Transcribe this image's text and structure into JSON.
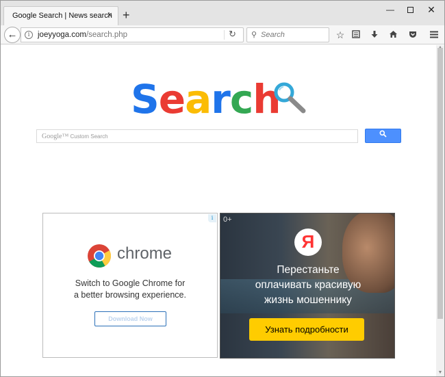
{
  "browser": {
    "tab_title": "Google Search | News search",
    "tab_close": "×",
    "new_tab": "+",
    "url_host": "joeyyoga.com",
    "url_path": "/search.php",
    "search_placeholder": "Search",
    "window_min": "—",
    "window_close": "✕"
  },
  "page": {
    "logo_letters": [
      {
        "char": "S",
        "color": "#1f74ea"
      },
      {
        "char": "e",
        "color": "#ea3b33"
      },
      {
        "char": "a",
        "color": "#fbbc05"
      },
      {
        "char": "r",
        "color": "#1f74ea"
      },
      {
        "char": "c",
        "color": "#34a853"
      },
      {
        "char": "h",
        "color": "#ea3b33"
      }
    ],
    "custom_search_brand": "Google™",
    "custom_search_label": "Custom Search"
  },
  "ads": {
    "chrome": {
      "brand": "chrome",
      "text_line1": "Switch to Google Chrome for",
      "text_line2": "a better browsing experience.",
      "button": "Download Now"
    },
    "yandex": {
      "age": "0+",
      "logo_letter": "Я",
      "line1": "Перестаньте",
      "line2": "оплачивать красивую",
      "line3": "жизнь мошеннику",
      "button": "Узнать подробности"
    }
  }
}
